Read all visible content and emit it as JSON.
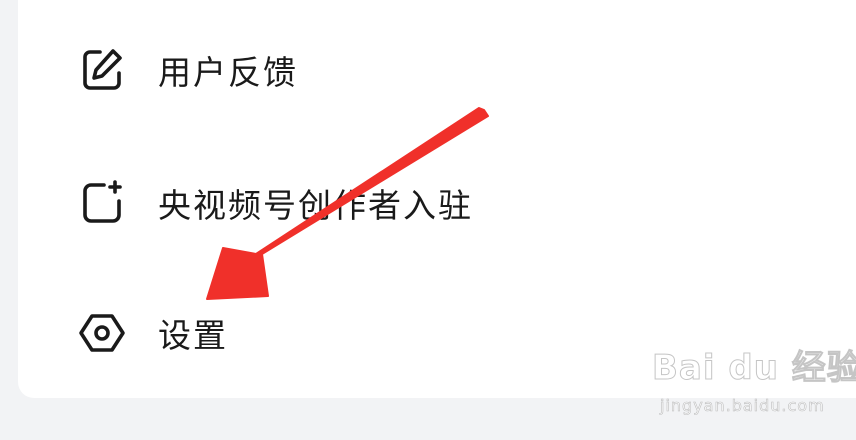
{
  "menu": {
    "items": [
      {
        "label": "用户反馈",
        "icon": "edit-icon"
      },
      {
        "label": "央视频号创作者入驻",
        "icon": "add-square-icon"
      },
      {
        "label": "设置",
        "icon": "settings-icon"
      }
    ]
  },
  "annotation": {
    "arrow_color": "#f0302a"
  },
  "watermark": {
    "logo_text": "Bai du 经验",
    "url": "jingyan.baidu.com"
  }
}
